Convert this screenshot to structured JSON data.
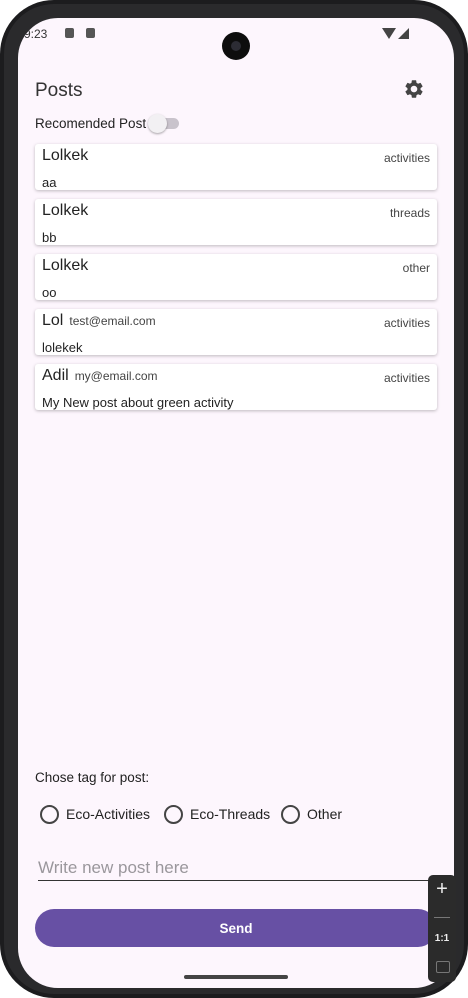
{
  "status": {
    "time": "9:23"
  },
  "header": {
    "title": "Posts",
    "settings_icon": "gear-icon"
  },
  "recommended": {
    "label": "Recomended Post",
    "enabled": false
  },
  "posts": [
    {
      "author": "Lolkek",
      "email": "",
      "tag": "activities",
      "content": "aa"
    },
    {
      "author": "Lolkek",
      "email": "",
      "tag": "threads",
      "content": "bb"
    },
    {
      "author": "Lolkek",
      "email": "",
      "tag": "other",
      "content": "oo"
    },
    {
      "author": "Lol",
      "email": "test@email.com",
      "tag": "activities",
      "content": "lolekek"
    },
    {
      "author": "Adil",
      "email": "my@email.com",
      "tag": "activities",
      "content": "My New post about green activity"
    }
  ],
  "tag_chooser": {
    "label": "Chose tag for post:",
    "options": [
      "Eco-Activities",
      "Eco-Threads",
      "Other"
    ]
  },
  "compose": {
    "placeholder": "Write new post here",
    "value": ""
  },
  "send_button": {
    "label": "Send"
  },
  "zoom_controls": {
    "plus": "+",
    "one_to_one": "1:1"
  },
  "colors": {
    "accent": "#6750a4",
    "background": "#fdf6fd"
  }
}
